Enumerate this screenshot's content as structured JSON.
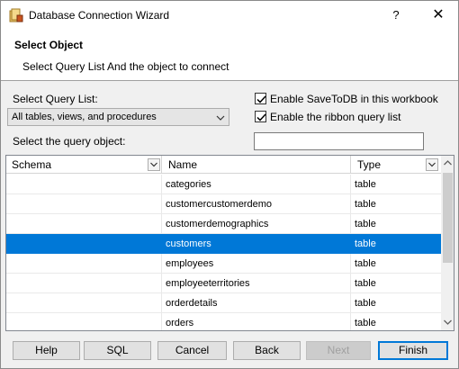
{
  "window": {
    "title": "Database Connection Wizard",
    "help_glyph": "?",
    "close_glyph": "✕"
  },
  "header": {
    "title": "Select Object",
    "subtitle": "Select Query List And the object to connect"
  },
  "form": {
    "query_list_label": "Select Query List:",
    "query_list_value": "All tables, views, and procedures",
    "query_object_label": "Select the query object:",
    "query_object_value": "",
    "checkbox_savetodb": {
      "label": "Enable SaveToDB in this workbook",
      "checked": true
    },
    "checkbox_ribbon": {
      "label": "Enable the ribbon query list",
      "checked": true
    }
  },
  "grid": {
    "columns": [
      "Schema",
      "Name",
      "Type"
    ],
    "rows": [
      {
        "schema": "",
        "name": "categories",
        "type": "table"
      },
      {
        "schema": "",
        "name": "customercustomerdemo",
        "type": "table"
      },
      {
        "schema": "",
        "name": "customerdemographics",
        "type": "table"
      },
      {
        "schema": "",
        "name": "customers",
        "type": "table",
        "selected": true
      },
      {
        "schema": "",
        "name": "employees",
        "type": "table"
      },
      {
        "schema": "",
        "name": "employeeterritories",
        "type": "table"
      },
      {
        "schema": "",
        "name": "orderdetails",
        "type": "table"
      },
      {
        "schema": "",
        "name": "orders",
        "type": "table"
      }
    ]
  },
  "buttons": {
    "help": "Help",
    "sql": "SQL",
    "cancel": "Cancel",
    "back": "Back",
    "next": "Next",
    "finish": "Finish"
  },
  "colors": {
    "accent": "#0078d7",
    "selected_text": "#ffffff"
  },
  "icons": {
    "app": "database-wizard-icon",
    "filter": "filter-dropdown-icon",
    "check": "checkmark-icon"
  }
}
